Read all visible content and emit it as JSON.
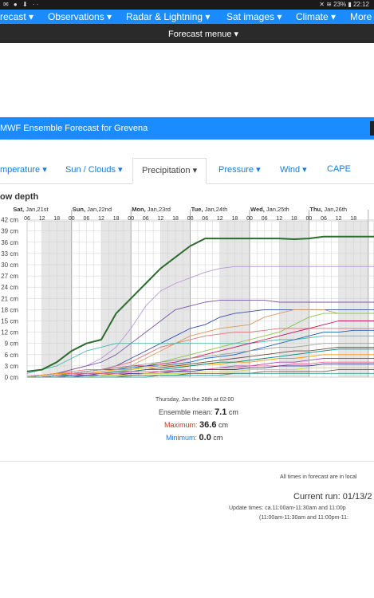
{
  "statusbar": {
    "left": "✉ ● ⬇ ·· ",
    "right": "✕ ≋ 23% ▮ 22:12"
  },
  "topnav": {
    "items": [
      "recast ▾",
      "Observations ▾",
      "Radar & Lightning ▾",
      "Sat images ▾",
      "Climate ▾",
      "More"
    ]
  },
  "subnav": {
    "label": "Forecast menue ▾"
  },
  "banner": {
    "title": "MWF Ensemble Forecast for Grevena"
  },
  "tabs": [
    "mperature ▾",
    "Sun / Clouds ▾",
    "Precipitation ▾",
    "Pressure ▾",
    "Wind ▾",
    "CAPE"
  ],
  "chart_title": "ow depth",
  "info": {
    "time": "Thursday, Jan the 26th at 02:00",
    "mean_label": "Ensemble mean:",
    "mean_value": "7.1",
    "max_label": "Maximum:",
    "max_value": "36.6",
    "min_label": "Minimum:",
    "min_value": "0.0",
    "unit": "cm"
  },
  "footer": {
    "note": "All times in forecast are in local",
    "run": "Current run: 01/13/2",
    "update1": "Update times: ca.11:00am-11:30am and 11:00p",
    "update2": "(11:00am-11:30am and 11:00pm-11:"
  },
  "colors": {
    "brand": "#1a8cff",
    "mean": "#2e6b2e",
    "max_label": "#c0392b",
    "min_label": "#1a7ad9"
  },
  "chart_data": {
    "type": "line",
    "title": "ow depth",
    "days": [
      "Sat, Jan,21st",
      "Sun, Jan,22nd",
      "Mon, Jan,23rd",
      "Tue, Jan,24th",
      "Wed, Jan,25th",
      "Thu, Jan,26th"
    ],
    "hour_ticks": [
      "06",
      "12",
      "18",
      "00",
      "06",
      "12",
      "18",
      "00",
      "06",
      "12",
      "18",
      "00",
      "06",
      "12",
      "18",
      "00",
      "06",
      "12",
      "18",
      "00",
      "06",
      "12",
      "18"
    ],
    "y_ticks": [
      "0 cm",
      "3 cm",
      "6 cm",
      "9 cm",
      "12 cm",
      "15 cm",
      "18 cm",
      "21 cm",
      "24 cm",
      "27 cm",
      "30 cm",
      "33 cm",
      "36 cm",
      "39 cm",
      "42 cm"
    ],
    "ylim": [
      0,
      42
    ],
    "x": [
      0,
      6,
      12,
      18,
      24,
      30,
      36,
      42,
      48,
      54,
      60,
      66,
      72,
      78,
      84,
      90,
      96,
      102,
      108,
      114,
      120,
      126,
      132
    ],
    "series": [
      {
        "color": "#2e6b2e",
        "width": 2,
        "values": [
          1.5,
          2,
          4,
          7,
          9,
          10,
          17,
          21,
          25,
          29,
          32,
          35,
          37,
          37,
          37,
          37,
          37,
          37,
          36.8,
          37,
          37.5,
          37.5,
          37.5
        ]
      },
      {
        "color": "#b89ad6",
        "values": [
          0.5,
          0.5,
          1,
          2,
          3,
          5,
          8,
          13,
          19,
          23,
          25,
          26.5,
          28,
          29,
          29.5,
          29.5,
          29.5,
          29.5,
          29.5,
          29.5,
          29.5,
          29.5,
          29.5
        ]
      },
      {
        "color": "#7e57a8",
        "values": [
          0,
          0.5,
          1,
          2,
          3,
          4,
          6,
          9,
          12,
          15,
          18,
          19,
          20,
          20.5,
          20.5,
          20.5,
          20.5,
          20,
          20,
          20,
          20,
          20,
          20
        ]
      },
      {
        "color": "#3b4fa8",
        "values": [
          0,
          0,
          0.5,
          1,
          1.5,
          2,
          3,
          5,
          7,
          9,
          11,
          13,
          14,
          16,
          17,
          17.5,
          18,
          18,
          18,
          18,
          18,
          18,
          18
        ]
      },
      {
        "color": "#d99a5b",
        "values": [
          0,
          0,
          0.5,
          1,
          1,
          1.5,
          2,
          3,
          5,
          7,
          9,
          11,
          12,
          13,
          13.5,
          14,
          16,
          17,
          18,
          18,
          18,
          17,
          17
        ]
      },
      {
        "color": "#8bc34a",
        "values": [
          0,
          0,
          0,
          0.5,
          1,
          1,
          1.5,
          2,
          3,
          4,
          5,
          6,
          7,
          8,
          9,
          10,
          11,
          12,
          14,
          16,
          17,
          17,
          17
        ]
      },
      {
        "color": "#e57373",
        "values": [
          0,
          0.5,
          1,
          1.5,
          2,
          2,
          3,
          4,
          6,
          8,
          9,
          10,
          11,
          11.5,
          12,
          12,
          12.5,
          13,
          13,
          13,
          13,
          13,
          13
        ]
      },
      {
        "color": "#4db6ac",
        "values": [
          1,
          2,
          3,
          5,
          7,
          8,
          9,
          9,
          9,
          9,
          9,
          9,
          9,
          9,
          9,
          9,
          9.5,
          10,
          10,
          10.5,
          11,
          11,
          11
        ]
      },
      {
        "color": "#c2185b",
        "values": [
          0,
          0,
          0.5,
          1,
          1.5,
          2,
          2.5,
          3,
          3,
          3.5,
          4,
          5,
          6,
          7,
          8,
          9,
          10,
          11,
          12,
          13,
          14,
          15,
          15
        ]
      },
      {
        "color": "#1565c0",
        "values": [
          0,
          0.5,
          1,
          1,
          1.5,
          2,
          2,
          2.5,
          3,
          3,
          3.5,
          4,
          5,
          5.5,
          6,
          7,
          8,
          9,
          10,
          11,
          12,
          12,
          12.5
        ]
      },
      {
        "color": "#9e9e9e",
        "values": [
          0,
          0,
          0.5,
          1,
          1.5,
          2,
          2.5,
          3,
          3.5,
          4,
          4.5,
          5,
          5.5,
          6,
          6.5,
          7,
          7.5,
          8,
          8,
          8.5,
          9,
          9,
          9
        ]
      },
      {
        "color": "#ff9800",
        "values": [
          0,
          0.5,
          1,
          1,
          1,
          1.5,
          2,
          2,
          2.5,
          3,
          3,
          3,
          3.5,
          3.5,
          4,
          4,
          4.5,
          5,
          5,
          5.5,
          6,
          6,
          6
        ]
      },
      {
        "color": "#6d4c41",
        "values": [
          0,
          0,
          0,
          0.5,
          0.5,
          1,
          1,
          1.5,
          2,
          2.5,
          3,
          3.5,
          4,
          4.5,
          5,
          5.5,
          6,
          6.5,
          7,
          7,
          7.5,
          8,
          8
        ]
      },
      {
        "color": "#00897b",
        "values": [
          0,
          0,
          0.5,
          0.5,
          1,
          1,
          1.5,
          1.5,
          2,
          2,
          2.5,
          3,
          3.5,
          4,
          4,
          4.5,
          5,
          5.5,
          6,
          6.5,
          7,
          7.5,
          7.5
        ]
      },
      {
        "color": "#ab47bc",
        "values": [
          0,
          0,
          0,
          0.5,
          0.5,
          0.5,
          1,
          1,
          1,
          1.5,
          1.5,
          2,
          2,
          2.5,
          3,
          3,
          3.5,
          4,
          4,
          4.5,
          5,
          5,
          5
        ]
      },
      {
        "color": "#f06292",
        "values": [
          0,
          0,
          0.5,
          1,
          1,
          1,
          1,
          1.5,
          1.5,
          1.5,
          2,
          2,
          2,
          2.5,
          2.5,
          3,
          3,
          3,
          3.5,
          3.5,
          4,
          4,
          4
        ]
      },
      {
        "color": "#283593",
        "values": [
          0,
          0,
          0,
          0,
          0.5,
          0.5,
          0.5,
          1,
          1,
          1,
          1.5,
          1.5,
          2,
          2,
          2,
          2.5,
          2.5,
          3,
          3,
          3,
          3.5,
          3.5,
          3.5
        ]
      },
      {
        "color": "#cddc39",
        "values": [
          0,
          0,
          0,
          0,
          0,
          0.5,
          0.5,
          0.5,
          1,
          1,
          1,
          1,
          1.5,
          1.5,
          1.5,
          2,
          2,
          2,
          2,
          2.5,
          2.5,
          2.5,
          2.5
        ]
      },
      {
        "color": "#795548",
        "values": [
          0,
          0,
          0,
          0,
          0,
          0,
          0,
          0.5,
          0.5,
          0.5,
          0.5,
          1,
          1,
          1,
          1,
          1,
          1.5,
          1.5,
          1.5,
          1.5,
          1.5,
          2,
          2
        ]
      },
      {
        "color": "#26a69a",
        "values": [
          0,
          0,
          0,
          0,
          0,
          0,
          0,
          0,
          0,
          0.5,
          0.5,
          0.5,
          0.5,
          0.5,
          1,
          1,
          1,
          1,
          1,
          1,
          1,
          1,
          1
        ]
      }
    ]
  }
}
